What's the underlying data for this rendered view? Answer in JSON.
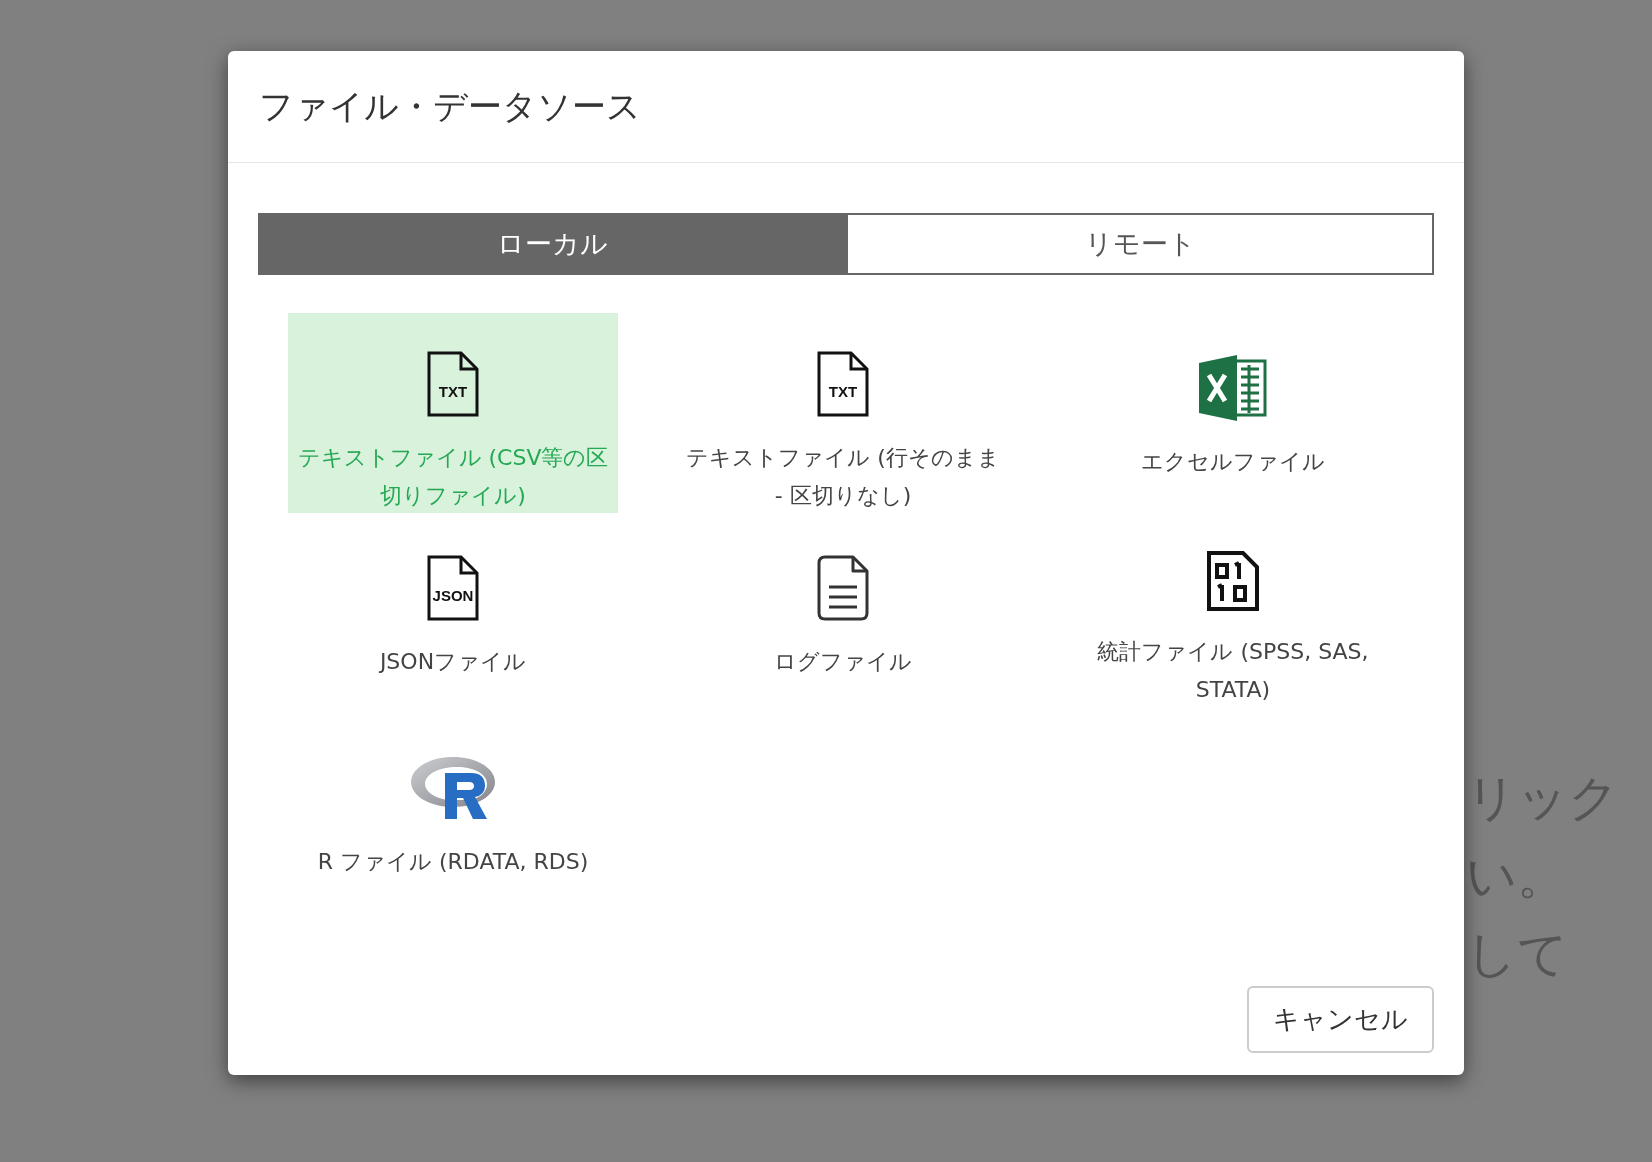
{
  "background_text": [
    "リック",
    "い。",
    "して"
  ],
  "dialog": {
    "title": "ファイル・データソース",
    "tabs": [
      {
        "label": "ローカル",
        "selected": true
      },
      {
        "label": "リモート",
        "selected": false
      }
    ],
    "items": [
      {
        "kind": "txt",
        "icon_text": "TXT",
        "label": "テキストファイル (CSV等の区切りファイル)",
        "selected": true
      },
      {
        "kind": "txt",
        "icon_text": "TXT",
        "label": "テキストファイル (行そのまま - 区切りなし)",
        "selected": false
      },
      {
        "kind": "excel",
        "label": "エクセルファイル",
        "selected": false
      },
      {
        "kind": "json",
        "icon_text": "JSON",
        "label": "JSONファイル",
        "selected": false
      },
      {
        "kind": "log",
        "label": "ログファイル",
        "selected": false
      },
      {
        "kind": "stats",
        "label": "統計ファイル (SPSS, SAS, STATA)",
        "selected": false
      },
      {
        "kind": "r",
        "label": "R ファイル (RDATA, RDS)",
        "selected": false
      }
    ],
    "cancel_button": "キャンセル"
  }
}
